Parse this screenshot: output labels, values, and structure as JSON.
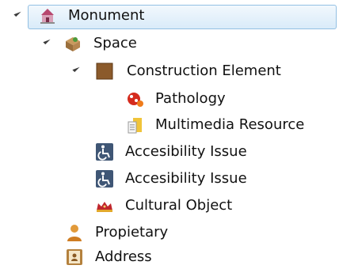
{
  "tree": {
    "nodes": [
      {
        "label": "Monument",
        "icon": "monument-icon",
        "expanded": true,
        "selected": true
      },
      {
        "label": "Space",
        "icon": "space-icon",
        "expanded": true
      },
      {
        "label": "Construction Element",
        "icon": "construction-element-icon",
        "expanded": true
      },
      {
        "label": "Pathology",
        "icon": "pathology-icon"
      },
      {
        "label": "Multimedia Resource",
        "icon": "multimedia-resource-icon"
      },
      {
        "label": "Accesibility Issue",
        "icon": "accessibility-icon"
      },
      {
        "label": "Accesibility Issue",
        "icon": "accessibility-icon"
      },
      {
        "label": "Cultural Object",
        "icon": "crown-icon"
      },
      {
        "label": "Propietary",
        "icon": "person-icon"
      },
      {
        "label": "Address",
        "icon": "address-book-icon"
      }
    ],
    "selection_color": "#d9ebf9",
    "selection_border": "#93c0e3"
  }
}
